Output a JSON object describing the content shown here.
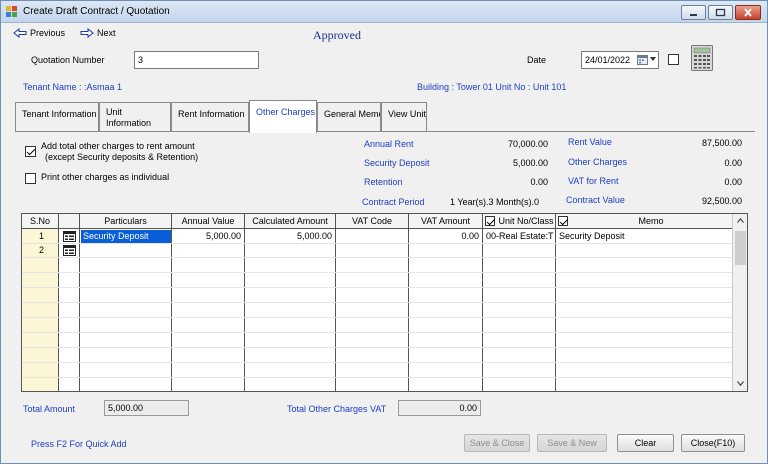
{
  "window": {
    "title": "Create Draft Contract / Quotation",
    "status": "Approved"
  },
  "toolbar": {
    "previous_label": "Previous",
    "next_label": "Next"
  },
  "header": {
    "quotation_label": "Quotation Number",
    "quotation_value": "3",
    "date_label": "Date",
    "date_value": "24/01/2022",
    "tenant_name": "Tenant Name : :Asmaa 1",
    "building_info": "Building : Tower 01  Unit No : Unit 101"
  },
  "tabs": [
    {
      "label": "Tenant Information"
    },
    {
      "label": "Unit Information"
    },
    {
      "label": "Rent Information"
    },
    {
      "label": "Other Charges"
    },
    {
      "label": "General Memo"
    },
    {
      "label": "View Unit"
    }
  ],
  "options": {
    "add_total_label": "Add total other charges to rent amount",
    "add_total_sub": "(except Security deposits  & Retention)",
    "add_total_checked": true,
    "print_individual_label": "Print other charges as individual",
    "print_individual_checked": false
  },
  "summary": {
    "annual_rent_label": "Annual Rent",
    "annual_rent_value": "70,000.00",
    "security_deposit_label": "Security Deposit",
    "security_deposit_value": "5,000.00",
    "retention_label": "Retention",
    "retention_value": "0.00",
    "contract_period_label": "Contract Period",
    "contract_period_value": "1 Year(s).3 Month(s).0",
    "rent_value_label": "Rent Value",
    "rent_value_value": "87,500.00",
    "other_charges_label": "Other Charges",
    "other_charges_value": "0.00",
    "vat_rent_label": "VAT for Rent",
    "vat_rent_value": "0.00",
    "contract_value_label": "Contract Value",
    "contract_value_value": "92,500.00"
  },
  "grid": {
    "columns": [
      "S.No",
      "",
      "Particulars",
      "Annual Value",
      "Calculated Amount",
      "VAT Code",
      "VAT Amount",
      "Unit No/Class",
      "Memo"
    ],
    "rows": [
      {
        "sno": "1",
        "particulars": "Security Deposit",
        "annual": "5,000.00",
        "calculated": "5,000.00",
        "vat_code": "",
        "vat_amount": "0.00",
        "unit": "00-Real Estate:T",
        "memo": "Security Deposit"
      },
      {
        "sno": "2",
        "particulars": "",
        "annual": "",
        "calculated": "",
        "vat_code": "",
        "vat_amount": "",
        "unit": "",
        "memo": ""
      }
    ]
  },
  "footer": {
    "total_amount_label": "Total Amount",
    "total_amount_value": "5,000.00",
    "total_vat_label": "Total Other Charges VAT",
    "total_vat_value": "0.00",
    "hint": "Press F2 For Quick Add",
    "save_close": "Save & Close",
    "save_new": "Save & New",
    "clear": "Clear",
    "close": "Close(F10)"
  }
}
